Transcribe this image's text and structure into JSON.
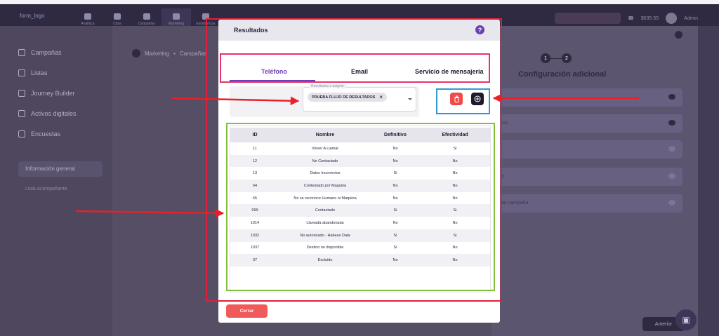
{
  "app": {
    "logo_text": "form_logo",
    "nav": [
      "Analítica",
      "Citas",
      "Campañas",
      "Marketing",
      "Estadísticas"
    ],
    "balance": "$635.55",
    "user": "Admin"
  },
  "sidebar": {
    "items": [
      "Campañas",
      "Listas",
      "Journey Builder",
      "Activos digitales",
      "Encuestas"
    ],
    "section": "Información general",
    "sub": "Lista Acompañante"
  },
  "breadcrumb": {
    "parent": "Marketing",
    "current": "Campañas"
  },
  "right_panel": {
    "title": "Configuración adicional",
    "steps": [
      "1",
      "2"
    ],
    "rows": [
      "",
      "tos",
      "",
      "a",
      "an campaña"
    ],
    "anterior": "Anterior"
  },
  "modal": {
    "title": "Resultados",
    "help": "?",
    "tabs": [
      "Teléfono",
      "Email",
      "Servicio de mensajería"
    ],
    "active_tab": "Teléfono",
    "select_label": "Resultados a asignar",
    "chip": "PRUEBA FLUJO DE RESULTADOS",
    "chip_remove": "×",
    "delete_icon": "trash-icon",
    "add_icon": "plus-circle-icon",
    "table": {
      "headers": [
        "ID",
        "Nombre",
        "Definitivo",
        "Efectividad"
      ],
      "rows": [
        [
          "11",
          "Volver A Llamar",
          "No",
          "Si"
        ],
        [
          "12",
          "No Contactado",
          "No",
          "No"
        ],
        [
          "13",
          "Datos Incorrectos",
          "Si",
          "No"
        ],
        [
          "64",
          "Contestado por Maquina",
          "No",
          "No"
        ],
        [
          "65",
          "No se reconoce Humano ni Maquina",
          "No",
          "No"
        ],
        [
          "999",
          "Contactado",
          "Si",
          "Si"
        ],
        [
          "1014",
          "Llamada abandonada",
          "No",
          "No"
        ],
        [
          "1032",
          "No autorizado - Habeas Data",
          "Si",
          "Si"
        ],
        [
          "1037",
          "Destino no disponible",
          "Si",
          "No"
        ],
        [
          "37",
          "Excluido",
          "No",
          "No"
        ]
      ]
    },
    "close_label": "Cerrar"
  },
  "colors": {
    "accent": "#6c3fb8",
    "danger": "#ef4b4b",
    "annotation_red": "#e0203a",
    "annotation_pink": "#e8316a",
    "annotation_blue": "#2e9ad6",
    "annotation_green": "#7fc23a"
  }
}
